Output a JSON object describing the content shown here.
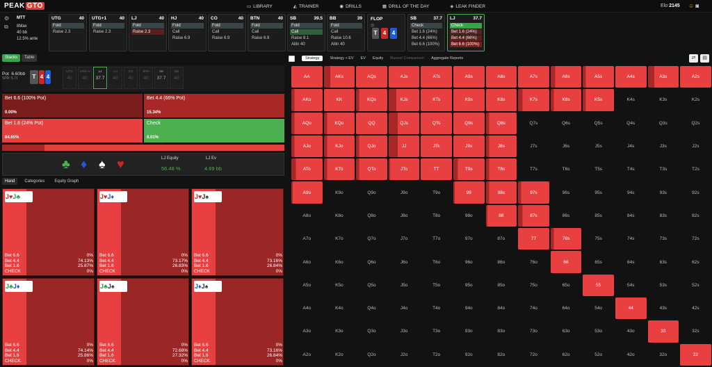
{
  "brand": {
    "logo_a": "PEAK",
    "logo_b": "GTO"
  },
  "nav": [
    "LIBRARY",
    "TRAINER",
    "DRILLS",
    "DRILL OF THE DAY",
    "LEAK FINDER"
  ],
  "elo": {
    "label": "Elo",
    "value": "2145"
  },
  "game": {
    "type": "MTT",
    "max": "8Max",
    "stack": "40 bb",
    "ante": "12.5% ante"
  },
  "seats": [
    {
      "pos": "UTG",
      "stack": "40",
      "actions": [
        "Fold",
        "Raise 2.3"
      ]
    },
    {
      "pos": "UTG+1",
      "stack": "40",
      "actions": [
        "Fold",
        "Raise 2.3"
      ]
    },
    {
      "pos": "LJ",
      "stack": "40",
      "actions": [
        "Fold",
        "Raise 2.3"
      ]
    },
    {
      "pos": "HJ",
      "stack": "40",
      "actions": [
        "Fold",
        "Call",
        "Raise 6.9"
      ]
    },
    {
      "pos": "CO",
      "stack": "40",
      "actions": [
        "Fold",
        "Call",
        "Raise 6.9"
      ]
    },
    {
      "pos": "BTN",
      "stack": "40",
      "actions": [
        "Fold",
        "Call",
        "Raise 6.9"
      ]
    },
    {
      "pos": "SB",
      "stack": "39.5",
      "actions": [
        "Fold",
        "Call",
        "Raise 8.1",
        "Allin 40"
      ]
    },
    {
      "pos": "BB",
      "stack": "39",
      "actions": [
        "Fold",
        "Call",
        "Raise 10.6",
        "Allin 40"
      ]
    }
  ],
  "flop": {
    "label": "FLOP",
    "cards": [
      "T",
      "4",
      "4"
    ]
  },
  "sb_post": {
    "pos": "SB",
    "stack": "37.7",
    "actions": [
      "Check",
      "Bet 1.6 (24%)",
      "Bet 4.4 (66%)",
      "Bet 6.6 (100%)"
    ]
  },
  "lj_post": {
    "pos": "LJ",
    "stack": "37.7",
    "actions": [
      "Check",
      "Bet 1.6 (24%)",
      "Bet 4.4 (66%)",
      "Bet 6.6 (100%)"
    ]
  },
  "toggle": {
    "stacks": "Stacks",
    "table": "Table"
  },
  "pot": {
    "label": "Pot",
    "value": "6.60bb",
    "spr": "SPR: 5.71"
  },
  "mini_seats": [
    {
      "pos": "UTG",
      "val": "40"
    },
    {
      "pos": "UTG+1",
      "val": "40"
    },
    {
      "pos": "LJ",
      "val": "37.7"
    },
    {
      "pos": "HJ",
      "val": "40"
    },
    {
      "pos": "CO",
      "val": "40"
    },
    {
      "pos": "BTN",
      "val": "40"
    },
    {
      "pos": "SB",
      "val": "37.7"
    },
    {
      "pos": "BB",
      "val": "40"
    }
  ],
  "strategy": {
    "bet66": {
      "label": "Bet 6.6 (100% Pot)",
      "pct": "0.00%"
    },
    "bet44": {
      "label": "Bet 4.4 (66% Pot)",
      "pct": "15.34%"
    },
    "bet16": {
      "label": "Bet 1.6 (24% Pot)",
      "pct": "84.65%"
    },
    "check": {
      "label": "Check",
      "pct": "0.01%"
    }
  },
  "equity": {
    "eq_label": "LJ Equity",
    "eq_value": "56.48 %",
    "ev_label": "LJ Ev",
    "ev_value": "4.69 bb"
  },
  "hand_tabs": [
    "Hand",
    "Categories",
    "Equity Graph"
  ],
  "hand_cards": [
    {
      "c1": "J",
      "s1": "heart",
      "c2": "J",
      "s2": "club",
      "rows": [
        [
          "Bet 6.6",
          "0%"
        ],
        [
          "Bet 4.4",
          "74.13%"
        ],
        [
          "Bet 1.6",
          "25.87%"
        ],
        [
          "CHECK",
          "0%"
        ]
      ]
    },
    {
      "c1": "J",
      "s1": "heart",
      "c2": "J",
      "s2": "diamond",
      "rows": [
        [
          "Bet 6.6",
          "0%"
        ],
        [
          "Bet 4.4",
          "73.17%"
        ],
        [
          "Bet 1.6",
          "26.83%"
        ],
        [
          "CHECK",
          "0%"
        ]
      ]
    },
    {
      "c1": "J",
      "s1": "heart",
      "c2": "J",
      "s2": "spade",
      "rows": [
        [
          "Bet 6.6",
          "0%"
        ],
        [
          "Bet 4.4",
          "73.16%"
        ],
        [
          "Bet 1.6",
          "26.84%"
        ],
        [
          "CHECK",
          "0%"
        ]
      ]
    },
    {
      "c1": "J",
      "s1": "club",
      "c2": "J",
      "s2": "diamond",
      "rows": [
        [
          "Bet 6.6",
          "0%"
        ],
        [
          "Bet 4.4",
          "74.14%"
        ],
        [
          "Bet 1.6",
          "25.86%"
        ],
        [
          "CHECK",
          "0%"
        ]
      ]
    },
    {
      "c1": "J",
      "s1": "club",
      "c2": "J",
      "s2": "spade",
      "rows": [
        [
          "Bet 6.6",
          "0%"
        ],
        [
          "Bet 4.4",
          "72.68%"
        ],
        [
          "Bet 1.6",
          "27.32%"
        ],
        [
          "CHECK",
          "0%"
        ]
      ]
    },
    {
      "c1": "J",
      "s1": "diamond",
      "c2": "J",
      "s2": "spade",
      "rows": [
        [
          "Bet 6.6",
          "0%"
        ],
        [
          "Bet 4.4",
          "73.16%"
        ],
        [
          "Bet 1.6",
          "26.84%"
        ],
        [
          "CHECK",
          "0%"
        ]
      ]
    }
  ],
  "right_tabs": [
    "Strategy",
    "Strategy + EV",
    "EV",
    "Equity",
    "Runout Comparison",
    "Aggregate Reports"
  ],
  "matrix": [
    [
      "AA",
      "AKs",
      "AQs",
      "AJs",
      "ATs",
      "A9s",
      "A8s",
      "A7s",
      "A6s",
      "A5s",
      "A4s",
      "A3s",
      "A2s"
    ],
    [
      "AKo",
      "KK",
      "KQs",
      "KJs",
      "KTs",
      "K9s",
      "K8s",
      "K7s",
      "K6s",
      "K5s",
      "K4s",
      "K3s",
      "K2s"
    ],
    [
      "AQo",
      "KQo",
      "QQ",
      "QJs",
      "QTs",
      "Q9s",
      "Q8s",
      "Q7s",
      "Q6s",
      "Q5s",
      "Q4s",
      "Q3s",
      "Q2s"
    ],
    [
      "AJo",
      "KJo",
      "QJo",
      "JJ",
      "JTs",
      "J9s",
      "J8s",
      "J7s",
      "J6s",
      "J5s",
      "J4s",
      "J3s",
      "J2s"
    ],
    [
      "ATo",
      "KTo",
      "QTo",
      "JTo",
      "TT",
      "T9s",
      "T8s",
      "T7s",
      "T6s",
      "T5s",
      "T4s",
      "T3s",
      "T2s"
    ],
    [
      "A9o",
      "K9o",
      "Q9o",
      "J9o",
      "T9o",
      "99",
      "98s",
      "97s",
      "96s",
      "95s",
      "94s",
      "93s",
      "92s"
    ],
    [
      "A8o",
      "K8o",
      "Q8o",
      "J8o",
      "T8o",
      "98o",
      "88",
      "87s",
      "86s",
      "85s",
      "84s",
      "83s",
      "82s"
    ],
    [
      "A7o",
      "K7o",
      "Q7o",
      "J7o",
      "T7o",
      "97o",
      "87o",
      "77",
      "76s",
      "75s",
      "74s",
      "73s",
      "72s"
    ],
    [
      "A6o",
      "K6o",
      "Q6o",
      "J6o",
      "T6o",
      "96o",
      "86o",
      "76o",
      "66",
      "65s",
      "64s",
      "63s",
      "62s"
    ],
    [
      "A5o",
      "K5o",
      "Q5o",
      "J5o",
      "T5o",
      "95o",
      "85o",
      "75o",
      "65o",
      "55",
      "54s",
      "53s",
      "52s"
    ],
    [
      "A4o",
      "K4o",
      "Q4o",
      "J4o",
      "T4o",
      "94o",
      "84o",
      "74o",
      "64o",
      "54o",
      "44",
      "43s",
      "42s"
    ],
    [
      "A3o",
      "K3o",
      "Q3o",
      "J3o",
      "T3o",
      "93o",
      "83o",
      "73o",
      "63o",
      "53o",
      "43o",
      "33",
      "32s"
    ],
    [
      "A2o",
      "K2o",
      "Q2o",
      "J2o",
      "T2o",
      "92o",
      "82o",
      "72o",
      "62o",
      "52o",
      "42o",
      "32o",
      "22"
    ]
  ],
  "colors": {
    "bet_big": "#7a1c1c",
    "bet_mid": "#a82828",
    "bet_small": "#e84040",
    "check": "#4caf50",
    "bg": "#121212"
  }
}
